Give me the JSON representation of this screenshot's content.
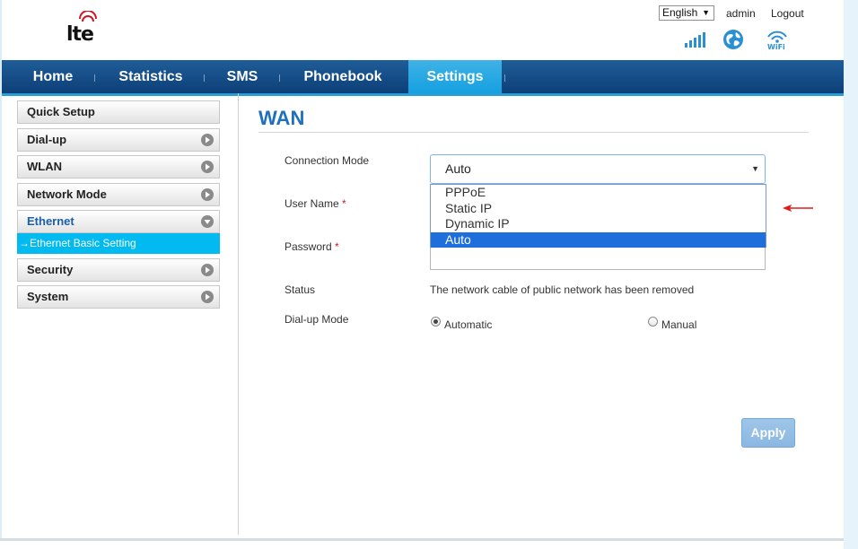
{
  "header": {
    "logo_text": "lte",
    "language": "English",
    "user": "admin",
    "logout_label": "Logout",
    "icons": [
      "signal-strength-icon",
      "internet-globe-icon",
      "wifi-icon"
    ]
  },
  "nav": {
    "items": [
      {
        "label": "Home",
        "active": false
      },
      {
        "label": "Statistics",
        "active": false
      },
      {
        "label": "SMS",
        "active": false
      },
      {
        "label": "Phonebook",
        "active": false
      },
      {
        "label": "Settings",
        "active": true
      }
    ]
  },
  "sidebar": {
    "items": [
      {
        "label": "Quick Setup",
        "has_chevron": false
      },
      {
        "label": "Dial-up",
        "has_chevron": true
      },
      {
        "label": "WLAN",
        "has_chevron": true
      },
      {
        "label": "Network Mode",
        "has_chevron": true
      },
      {
        "label": "Ethernet",
        "has_chevron": true,
        "expanded": true
      },
      {
        "label": "Security",
        "has_chevron": true
      },
      {
        "label": "System",
        "has_chevron": true
      }
    ],
    "sub_item": "→Ethernet Basic Setting"
  },
  "main": {
    "title": "WAN",
    "form": {
      "connection_mode_label": "Connection Mode",
      "connection_mode_value": "Auto",
      "connection_mode_options": [
        "PPPoE",
        "Static IP",
        "Dynamic IP",
        "Auto"
      ],
      "username_label": "User Name",
      "password_label": "Password",
      "required_mark": "*",
      "status_label": "Status",
      "status_value": "The network cable of public network has been removed",
      "dialup_mode_label": "Dial-up Mode",
      "dialup_options": [
        {
          "label": "Automatic",
          "checked": true
        },
        {
          "label": "Manual",
          "checked": false
        }
      ]
    },
    "apply_label": "Apply"
  },
  "colors": {
    "nav_bg": "#0d3f78",
    "nav_active": "#15a0e0",
    "accent": "#1f6fbf",
    "sub_item_bg": "#00baf0",
    "annotation_arrow": "#e01b1b"
  }
}
